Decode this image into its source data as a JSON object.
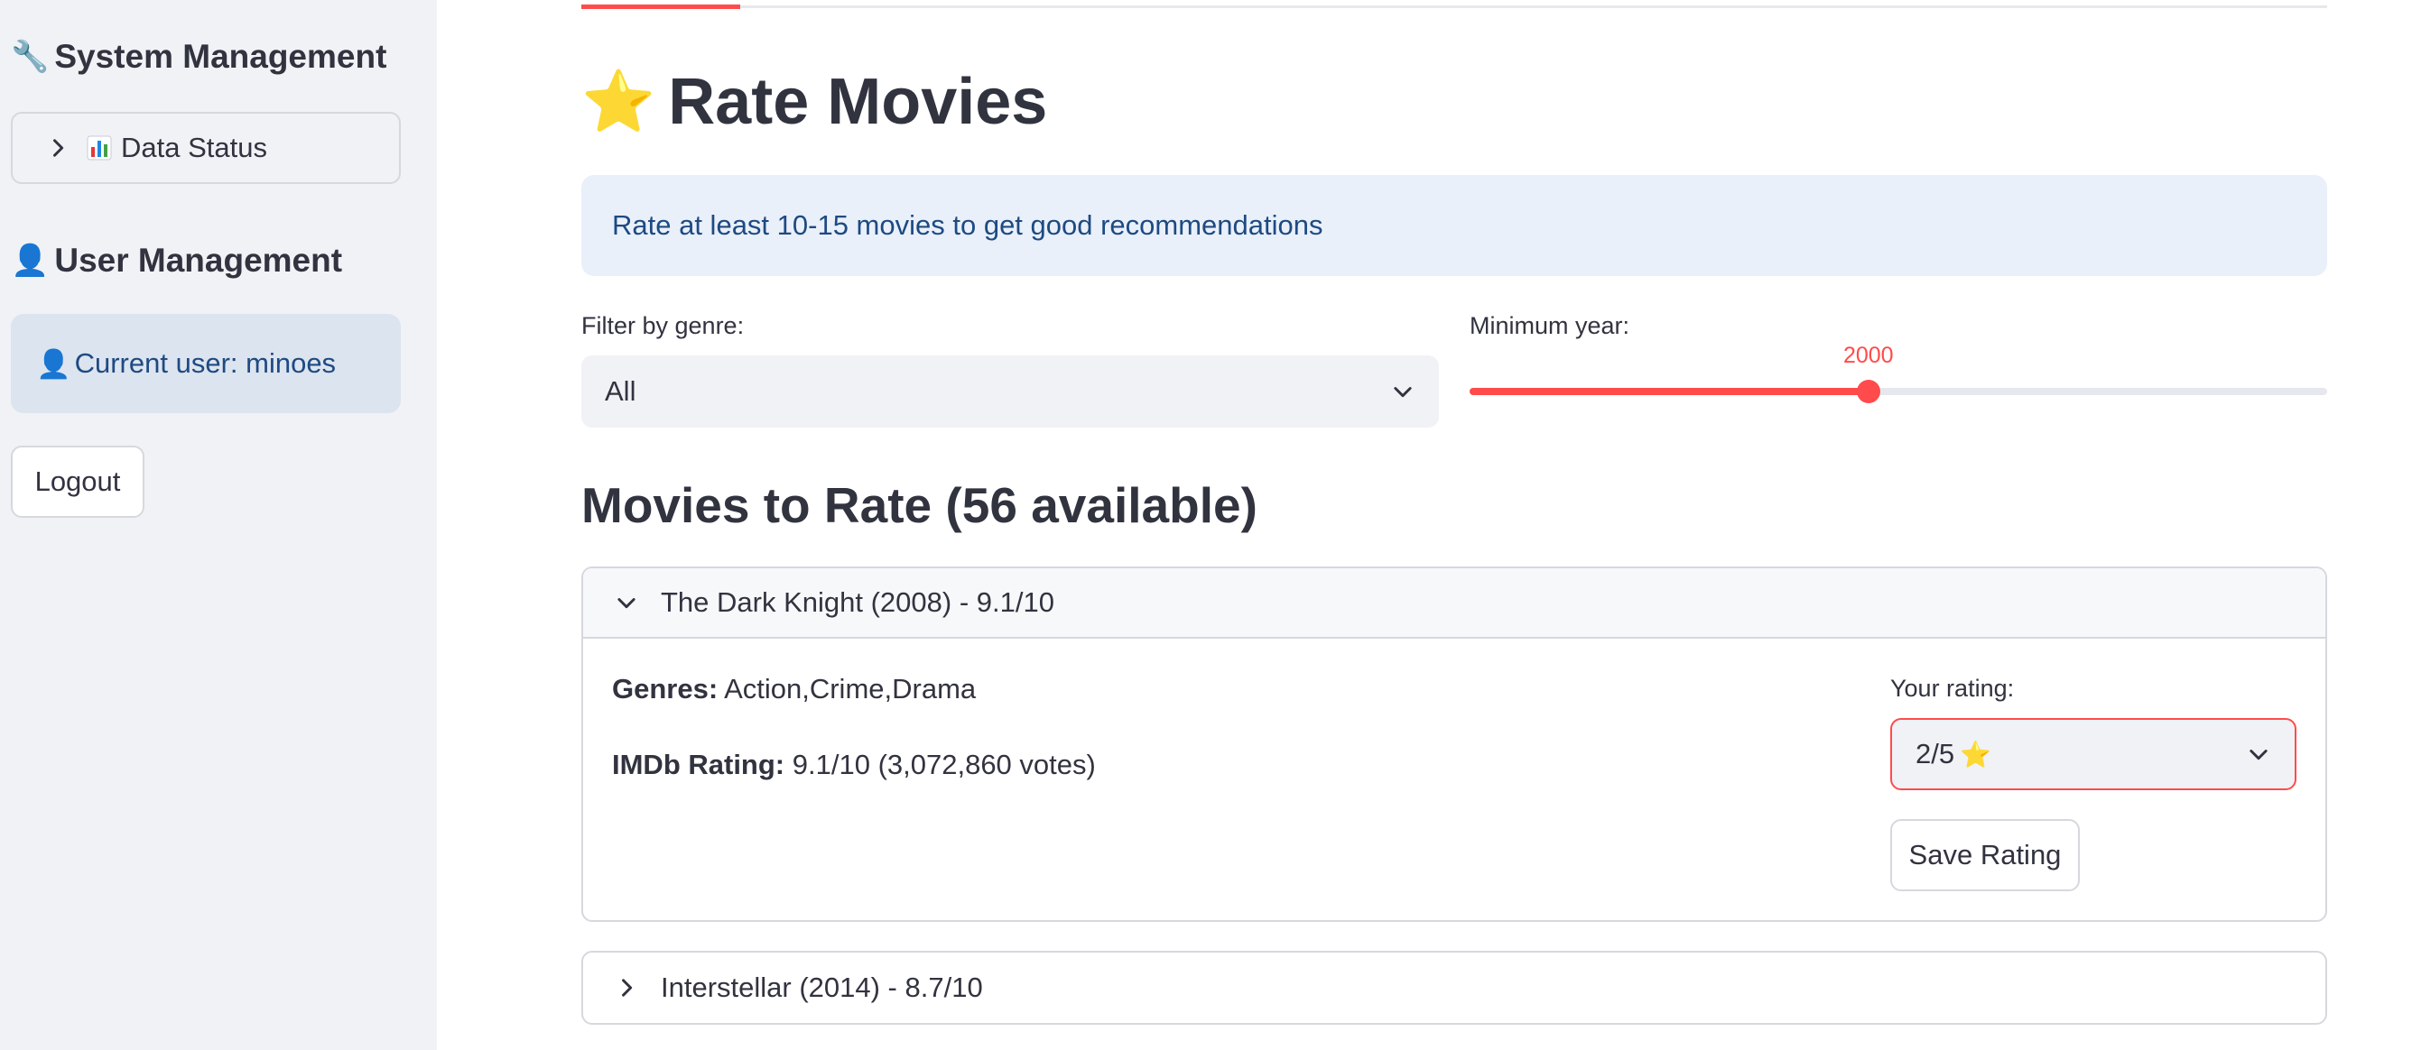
{
  "sidebar": {
    "system_heading": "System Management",
    "system_icon": "wrench-icon",
    "data_status_label": "Data Status",
    "data_status_icon": "bar-chart-icon",
    "user_heading": "User Management",
    "user_icon": "user-icon",
    "current_user_text": "Current user: minoes",
    "logout_label": "Logout"
  },
  "main": {
    "title": "Rate Movies",
    "title_icon": "star-icon",
    "info_text": "Rate at least 10-15 movies to get good recommendations",
    "genre_filter": {
      "label": "Filter by genre:",
      "value": "All"
    },
    "year_slider": {
      "label": "Minimum year:",
      "value": "2000",
      "fraction": 0.465
    },
    "section_title": "Movies to Rate (56 available)",
    "movies": [
      {
        "header": "The Dark Knight (2008) - 9.1/10",
        "expanded": true,
        "genres_label": "Genres:",
        "genres": "Action,Crime,Drama",
        "imdb_label": "IMDb Rating:",
        "imdb": "9.1/10 (3,072,860 votes)",
        "rating_label": "Your rating:",
        "rating_value": "2/5",
        "save_label": "Save Rating"
      },
      {
        "header": "Interstellar (2014) - 8.7/10",
        "expanded": false
      }
    ]
  },
  "colors": {
    "accent": "#ff4b4b",
    "sidebar_bg": "#f0f2f6",
    "info_bg": "#e9f0fa",
    "info_text": "#1e4a82"
  }
}
